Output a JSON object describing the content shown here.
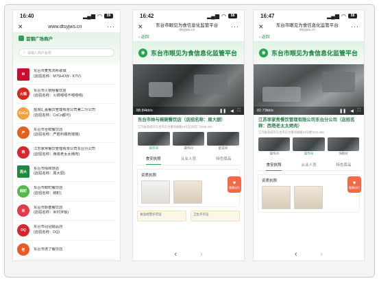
{
  "phone1": {
    "time": "16:40",
    "url": "www.dtsyjws.cn",
    "brand": "首钢广场商户",
    "search_placeholder": "请输入商户名称",
    "items": [
      {
        "logo_text": "M",
        "logo_color": "#c8102e",
        "square": true,
        "name": "东台市麦秀鸿听歌城",
        "sign": "(店招名称：M7SHOW - KTV)"
      },
      {
        "logo_text": "火锅",
        "logo_color": "#d9261c",
        "name": "东台市火锅嘻餐饮店",
        "sign": "(店招名称：火锅嘻嘻不嘻嘻嘻)"
      },
      {
        "logo_text": "CoCo",
        "logo_color": "#f1a33c",
        "name": "盐城汇嘉餐饮管理有限公司第二分公司",
        "sign": "(店招名称：CoCo都可)"
      },
      {
        "logo_text": "严",
        "logo_color": "#e2611e",
        "name": "东台市全鲜餐饮店",
        "sign": "(店招名称：严胜利爆肉馆馆)"
      },
      {
        "logo_text": "西",
        "logo_color": "#d7262e",
        "name": "江苏家常餐饮管理有限公司东台分公司",
        "sign": "(店招名称：西塔老太太烤肉)"
      },
      {
        "logo_text": "周大",
        "logo_color": "#1e8a3d",
        "square": true,
        "name": "东台市情和饼店",
        "sign": "(店招名称：周大厨)"
      },
      {
        "logo_text": "鲜町",
        "logo_color": "#55b94a",
        "name": "东台市鲜町餐饮店",
        "sign": "(店招名称：鲜町)"
      },
      {
        "logo_text": "米",
        "logo_color": "#e23b4a",
        "name": "东台市斯善餐饮店",
        "sign": "(店招名称：米村拌饭)"
      },
      {
        "logo_text": "DQ",
        "logo_color": "#d7262e",
        "name": "东台市冠冠甜品店",
        "sign": "(店招名称：DQ)"
      },
      {
        "logo_text": "老",
        "logo_color": "#e85b26",
        "name": "东台市虎了餐饮店",
        "sign": ""
      }
    ]
  },
  "phone2": {
    "time": "16:42",
    "title": "东台市眼见为食信息化监管平台",
    "domain": "dtsyjws.cn",
    "back": "返回",
    "header": "东台市眼见为食信息化监管平台",
    "speed": "88.84kb/s",
    "shop": "东台市林与碗碗餐饮店（店招名称：周大厨）",
    "address": "江苏省盐城市东台市东台镇海丽路10号瓦房店门1030,403",
    "thumbs": [
      "操作间",
      "操作间",
      "配菜间"
    ],
    "tabs": [
      "食安执照",
      "从业人员",
      "特色菜品"
    ],
    "panel_title": "资质执照",
    "float_label": "健康出行",
    "cards": [
      "食品经营许可证",
      "卫生许可证"
    ]
  },
  "phone3": {
    "time": "16:47",
    "title": "东台市眼见为食信息化监管平台",
    "domain": "dtsyjws.cn",
    "back": "返回",
    "header": "东台市眼见为食信息化监管平台",
    "speed": "82.73kb/s",
    "shop": "江苏李家秀餐饮管理有限公司东台分公司（店招名称：西塔老太太烤肉）",
    "address": "江苏省盐城市东台市东台镇海丽路10号楼1040,403",
    "thumbs": [
      "操作间",
      "操作间",
      "洗碗间"
    ],
    "tabs": [
      "食安执照",
      "从业人员",
      "特色菜品"
    ],
    "panel_title": "资质执照",
    "float_label": "健康出行"
  }
}
